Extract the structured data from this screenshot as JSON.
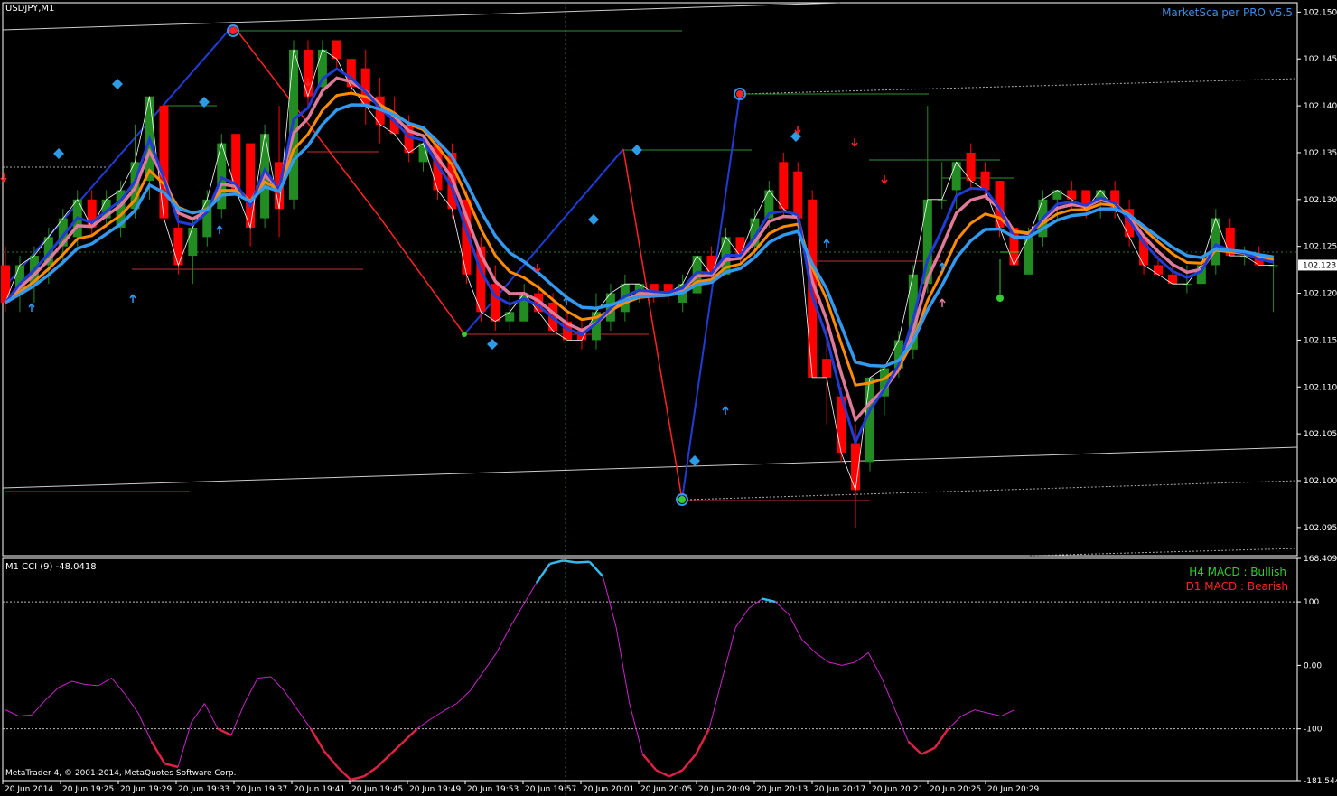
{
  "window": {
    "symbol_title": "USDJPY,M1",
    "indicator_title": "MarketScalper PRO v5.5",
    "copyright": "MetaTrader 4, © 2001-2014, MetaQuotes Software Corp."
  },
  "colors": {
    "background": "#000000",
    "bull_candle": "#228B22",
    "bear_candle": "#FF0000",
    "axis": "#FFFFFF",
    "indicator_title": "#3A8DDE",
    "fast_ma": "#1F3DD6",
    "slow_ma": "#3399EE",
    "orange_ma": "#FF8C00",
    "pink_ma": "#E07A9A",
    "cci_line": "#CC22CC",
    "cci_high": "#33BBEE",
    "cci_low": "#DD2244",
    "macd_bull": "#33CC33",
    "macd_bear": "#FF2222"
  },
  "price_axis": {
    "labels": [
      "102.150",
      "102.145",
      "102.140",
      "102.135",
      "102.130",
      "102.125",
      "102.120",
      "102.115",
      "102.110",
      "102.105",
      "102.100",
      "102.095"
    ],
    "current_price": "102.123"
  },
  "time_axis": {
    "labels": [
      "20 Jun 2014",
      "20 Jun 19:25",
      "20 Jun 19:29",
      "20 Jun 19:33",
      "20 Jun 19:37",
      "20 Jun 19:41",
      "20 Jun 19:45",
      "20 Jun 19:49",
      "20 Jun 19:53",
      "20 Jun 19:57",
      "20 Jun 20:01",
      "20 Jun 20:05",
      "20 Jun 20:09",
      "20 Jun 20:13",
      "20 Jun 20:17",
      "20 Jun 20:21",
      "20 Jun 20:25",
      "20 Jun 20:29"
    ]
  },
  "cci_panel": {
    "title": "M1 CCI (9) -48.0418",
    "axis_labels": [
      "168.4093",
      "100",
      "0.00",
      "-100",
      "-181.5443"
    ],
    "macd_h4": "H4 MACD : Bullish",
    "macd_d1": "D1 MACD : Bearish"
  },
  "chart_data": {
    "type": "candlestick",
    "symbol": "USDJPY",
    "timeframe": "M1",
    "ylim": [
      102.092,
      102.151
    ],
    "candles": [
      {
        "o": 102.123,
        "h": 102.125,
        "l": 102.118,
        "c": 102.119
      },
      {
        "o": 102.12,
        "h": 102.124,
        "l": 102.118,
        "c": 102.123
      },
      {
        "o": 102.121,
        "h": 102.125,
        "l": 102.119,
        "c": 102.124
      },
      {
        "o": 102.123,
        "h": 102.127,
        "l": 102.121,
        "c": 102.126
      },
      {
        "o": 102.125,
        "h": 102.129,
        "l": 102.123,
        "c": 102.128
      },
      {
        "o": 102.126,
        "h": 102.131,
        "l": 102.125,
        "c": 102.13
      },
      {
        "o": 102.13,
        "h": 102.131,
        "l": 102.126,
        "c": 102.127
      },
      {
        "o": 102.128,
        "h": 102.131,
        "l": 102.127,
        "c": 102.13
      },
      {
        "o": 102.127,
        "h": 102.132,
        "l": 102.126,
        "c": 102.131
      },
      {
        "o": 102.129,
        "h": 102.138,
        "l": 102.128,
        "c": 102.134
      },
      {
        "o": 102.132,
        "h": 102.141,
        "l": 102.13,
        "c": 102.141
      },
      {
        "o": 102.14,
        "h": 102.14,
        "l": 102.127,
        "c": 102.128
      },
      {
        "o": 102.127,
        "h": 102.129,
        "l": 102.122,
        "c": 102.123
      },
      {
        "o": 102.124,
        "h": 102.128,
        "l": 102.121,
        "c": 102.127
      },
      {
        "o": 102.126,
        "h": 102.131,
        "l": 102.125,
        "c": 102.13
      },
      {
        "o": 102.129,
        "h": 102.137,
        "l": 102.128,
        "c": 102.136
      },
      {
        "o": 102.137,
        "h": 102.137,
        "l": 102.131,
        "c": 102.131
      },
      {
        "o": 102.136,
        "h": 102.136,
        "l": 102.125,
        "c": 102.127
      },
      {
        "o": 102.128,
        "h": 102.138,
        "l": 102.127,
        "c": 102.137
      },
      {
        "o": 102.134,
        "h": 102.14,
        "l": 102.126,
        "c": 102.129
      },
      {
        "o": 102.13,
        "h": 102.147,
        "l": 102.129,
        "c": 102.146
      },
      {
        "o": 102.146,
        "h": 102.147,
        "l": 102.14,
        "c": 102.141
      },
      {
        "o": 102.142,
        "h": 102.147,
        "l": 102.141,
        "c": 102.146
      },
      {
        "o": 102.147,
        "h": 102.147,
        "l": 102.144,
        "c": 102.145
      },
      {
        "o": 102.145,
        "h": 102.145,
        "l": 102.141,
        "c": 102.142
      },
      {
        "o": 102.144,
        "h": 102.146,
        "l": 102.138,
        "c": 102.14
      },
      {
        "o": 102.141,
        "h": 102.143,
        "l": 102.136,
        "c": 102.138
      },
      {
        "o": 102.139,
        "h": 102.141,
        "l": 102.137,
        "c": 102.137
      },
      {
        "o": 102.138,
        "h": 102.139,
        "l": 102.134,
        "c": 102.135
      },
      {
        "o": 102.134,
        "h": 102.137,
        "l": 102.133,
        "c": 102.136
      },
      {
        "o": 102.136,
        "h": 102.136,
        "l": 102.13,
        "c": 102.131
      },
      {
        "o": 102.135,
        "h": 102.136,
        "l": 102.128,
        "c": 102.129
      },
      {
        "o": 102.13,
        "h": 102.131,
        "l": 102.121,
        "c": 102.122
      },
      {
        "o": 102.125,
        "h": 102.126,
        "l": 102.117,
        "c": 102.118
      },
      {
        "o": 102.121,
        "h": 102.123,
        "l": 102.116,
        "c": 102.117
      },
      {
        "o": 102.117,
        "h": 102.12,
        "l": 102.116,
        "c": 102.118
      },
      {
        "o": 102.117,
        "h": 102.121,
        "l": 102.117,
        "c": 102.12
      },
      {
        "o": 102.12,
        "h": 102.121,
        "l": 102.118,
        "c": 102.118
      },
      {
        "o": 102.119,
        "h": 102.12,
        "l": 102.116,
        "c": 102.116
      },
      {
        "o": 102.117,
        "h": 102.118,
        "l": 102.115,
        "c": 102.115
      },
      {
        "o": 102.116,
        "h": 102.117,
        "l": 102.114,
        "c": 102.115
      },
      {
        "o": 102.115,
        "h": 102.12,
        "l": 102.114,
        "c": 102.118
      },
      {
        "o": 102.117,
        "h": 102.121,
        "l": 102.116,
        "c": 102.12
      },
      {
        "o": 102.118,
        "h": 102.122,
        "l": 102.117,
        "c": 102.121
      },
      {
        "o": 102.12,
        "h": 102.121,
        "l": 102.119,
        "c": 102.121
      },
      {
        "o": 102.121,
        "h": 102.121,
        "l": 102.119,
        "c": 102.12
      },
      {
        "o": 102.121,
        "h": 102.121,
        "l": 102.119,
        "c": 102.12
      },
      {
        "o": 102.119,
        "h": 102.122,
        "l": 102.118,
        "c": 102.121
      },
      {
        "o": 102.12,
        "h": 102.125,
        "l": 102.119,
        "c": 102.124
      },
      {
        "o": 102.124,
        "h": 102.125,
        "l": 102.121,
        "c": 102.122
      },
      {
        "o": 102.122,
        "h": 102.127,
        "l": 102.122,
        "c": 102.126
      },
      {
        "o": 102.126,
        "h": 102.126,
        "l": 102.123,
        "c": 102.124
      },
      {
        "o": 102.125,
        "h": 102.129,
        "l": 102.124,
        "c": 102.128
      },
      {
        "o": 102.128,
        "h": 102.132,
        "l": 102.127,
        "c": 102.131
      },
      {
        "o": 102.134,
        "h": 102.135,
        "l": 102.128,
        "c": 102.129
      },
      {
        "o": 102.133,
        "h": 102.134,
        "l": 102.127,
        "c": 102.128
      },
      {
        "o": 102.13,
        "h": 102.131,
        "l": 102.111,
        "c": 102.111
      },
      {
        "o": 102.113,
        "h": 102.117,
        "l": 102.106,
        "c": 102.111
      },
      {
        "o": 102.109,
        "h": 102.11,
        "l": 102.102,
        "c": 102.103
      },
      {
        "o": 102.104,
        "h": 102.106,
        "l": 102.095,
        "c": 102.099
      },
      {
        "o": 102.102,
        "h": 102.111,
        "l": 102.101,
        "c": 102.111
      },
      {
        "o": 102.109,
        "h": 102.112,
        "l": 102.107,
        "c": 102.112
      },
      {
        "o": 102.112,
        "h": 102.116,
        "l": 102.111,
        "c": 102.115
      },
      {
        "o": 102.114,
        "h": 102.123,
        "l": 102.113,
        "c": 102.122
      },
      {
        "o": 102.121,
        "h": 102.14,
        "l": 102.12,
        "c": 102.13
      },
      {
        "o": 102.13,
        "h": 102.134,
        "l": 102.129,
        "c": 102.13
      },
      {
        "o": 102.131,
        "h": 102.134,
        "l": 102.129,
        "c": 102.134
      },
      {
        "o": 102.135,
        "h": 102.136,
        "l": 102.131,
        "c": 102.132
      },
      {
        "o": 102.133,
        "h": 102.134,
        "l": 102.13,
        "c": 102.131
      },
      {
        "o": 102.132,
        "h": 102.132,
        "l": 102.126,
        "c": 102.127
      },
      {
        "o": 102.127,
        "h": 102.127,
        "l": 102.122,
        "c": 102.123
      },
      {
        "o": 102.122,
        "h": 102.127,
        "l": 102.122,
        "c": 102.126
      },
      {
        "o": 102.126,
        "h": 102.131,
        "l": 102.125,
        "c": 102.13
      },
      {
        "o": 102.13,
        "h": 102.131,
        "l": 102.128,
        "c": 102.131
      },
      {
        "o": 102.131,
        "h": 102.132,
        "l": 102.129,
        "c": 102.13
      },
      {
        "o": 102.131,
        "h": 102.131,
        "l": 102.128,
        "c": 102.129
      },
      {
        "o": 102.13,
        "h": 102.131,
        "l": 102.128,
        "c": 102.131
      },
      {
        "o": 102.131,
        "h": 102.132,
        "l": 102.128,
        "c": 102.129
      },
      {
        "o": 102.129,
        "h": 102.13,
        "l": 102.125,
        "c": 102.126
      },
      {
        "o": 102.126,
        "h": 102.126,
        "l": 102.122,
        "c": 102.123
      },
      {
        "o": 102.123,
        "h": 102.124,
        "l": 102.122,
        "c": 102.122
      },
      {
        "o": 102.122,
        "h": 102.123,
        "l": 102.121,
        "c": 102.121
      },
      {
        "o": 102.121,
        "h": 102.123,
        "l": 102.12,
        "c": 102.121
      },
      {
        "o": 102.121,
        "h": 102.124,
        "l": 102.121,
        "c": 102.123
      },
      {
        "o": 102.123,
        "h": 102.129,
        "l": 102.122,
        "c": 102.128
      },
      {
        "o": 102.127,
        "h": 102.128,
        "l": 102.124,
        "c": 102.124
      },
      {
        "o": 102.124,
        "h": 102.125,
        "l": 102.123,
        "c": 102.124
      },
      {
        "o": 102.124,
        "h": 102.125,
        "l": 102.123,
        "c": 102.123
      },
      {
        "o": 102.123,
        "h": 102.124,
        "l": 102.118,
        "c": 102.123
      }
    ],
    "cci": [
      -70,
      -80,
      -78,
      -55,
      -35,
      -25,
      -30,
      -32,
      -20,
      -45,
      -75,
      -120,
      -155,
      -160,
      -90,
      -60,
      -100,
      -110,
      -60,
      -20,
      -18,
      -40,
      -70,
      -100,
      -135,
      -160,
      -180,
      -175,
      -160,
      -140,
      -120,
      -100,
      -85,
      -72,
      -60,
      -40,
      -10,
      20,
      60,
      95,
      130,
      160,
      165,
      162,
      163,
      140,
      60,
      -60,
      -140,
      -165,
      -175,
      -165,
      -140,
      -100,
      -20,
      60,
      90,
      105,
      100,
      80,
      40,
      20,
      5,
      0,
      5,
      20,
      -20,
      -70,
      -120,
      -140,
      -130,
      -100,
      -80,
      -70,
      -75,
      -80,
      -70
    ]
  }
}
